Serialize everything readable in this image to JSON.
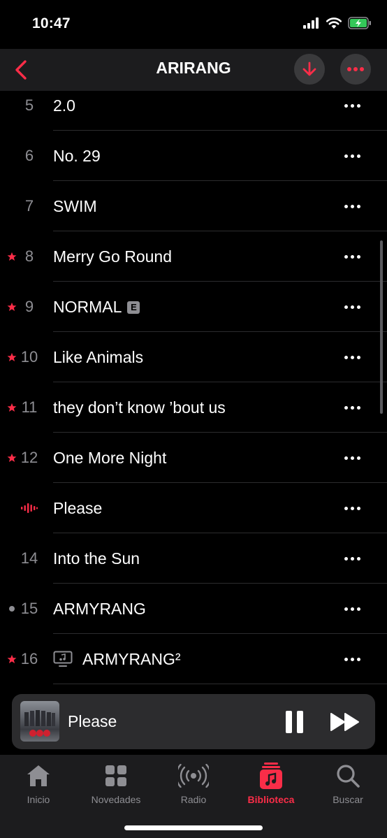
{
  "status_bar": {
    "time": "10:47"
  },
  "header": {
    "title": "ARIRANG",
    "icons": [
      "chevron-left-icon",
      "download-icon",
      "ellipsis-icon"
    ]
  },
  "tracks": [
    {
      "number": "5",
      "title": "2.0",
      "marker": "none"
    },
    {
      "number": "6",
      "title": "No. 29",
      "marker": "none"
    },
    {
      "number": "7",
      "title": "SWIM",
      "marker": "none"
    },
    {
      "number": "8",
      "title": "Merry Go Round",
      "marker": "star"
    },
    {
      "number": "9",
      "title": "NORMAL",
      "marker": "star",
      "explicit": "E"
    },
    {
      "number": "10",
      "title": "Like Animals",
      "marker": "star"
    },
    {
      "number": "11",
      "title": "they don’t know ’bout us",
      "marker": "star"
    },
    {
      "number": "12",
      "title": "One More Night",
      "marker": "star"
    },
    {
      "number": "",
      "title": "Please",
      "marker": "playing"
    },
    {
      "number": "14",
      "title": "Into the Sun",
      "marker": "none"
    },
    {
      "number": "15",
      "title": "ARMYRANG",
      "marker": "dot"
    },
    {
      "number": "16",
      "title": "ARMYRANG²",
      "marker": "star",
      "video": true
    }
  ],
  "mini_player": {
    "title": "Please"
  },
  "tabs": [
    {
      "label": "Inicio",
      "icon": "home-icon"
    },
    {
      "label": "Novedades",
      "icon": "grid-icon"
    },
    {
      "label": "Radio",
      "icon": "radio-icon"
    },
    {
      "label": "Biblioteca",
      "icon": "library-icon",
      "active": true
    },
    {
      "label": "Buscar",
      "icon": "search-icon"
    }
  ],
  "colors": {
    "accent": "#fa2d48",
    "background": "#000000",
    "secondary_text": "#8e8e93"
  }
}
